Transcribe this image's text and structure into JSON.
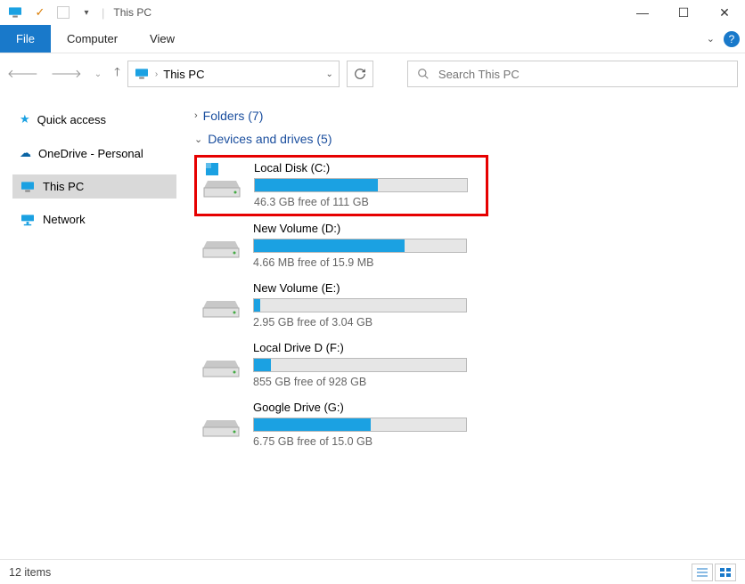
{
  "titlebar": {
    "title": "This PC"
  },
  "window_controls": {
    "minimize": "—",
    "maximize": "☐",
    "close": "✕"
  },
  "tabs": {
    "file": "File",
    "computer": "Computer",
    "view": "View"
  },
  "breadcrumb": {
    "label": "This PC"
  },
  "search": {
    "placeholder": "Search This PC"
  },
  "sidebar": {
    "items": [
      {
        "label": "Quick access"
      },
      {
        "label": "OneDrive - Personal"
      },
      {
        "label": "This PC"
      },
      {
        "label": "Network"
      }
    ]
  },
  "groups": {
    "folders": {
      "label": "Folders (7)"
    },
    "drives": {
      "label": "Devices and drives (5)"
    }
  },
  "drives": [
    {
      "name": "Local Disk (C:)",
      "status": "46.3 GB free of 111 GB",
      "used_pct": 58
    },
    {
      "name": "New Volume (D:)",
      "status": "4.66 MB free of 15.9 MB",
      "used_pct": 71
    },
    {
      "name": "New Volume (E:)",
      "status": "2.95 GB free of 3.04 GB",
      "used_pct": 3
    },
    {
      "name": "Local Drive D (F:)",
      "status": "855 GB free of 928 GB",
      "used_pct": 8
    },
    {
      "name": "Google Drive (G:)",
      "status": "6.75 GB free of 15.0 GB",
      "used_pct": 55
    }
  ],
  "statusbar": {
    "items": "12 items"
  }
}
